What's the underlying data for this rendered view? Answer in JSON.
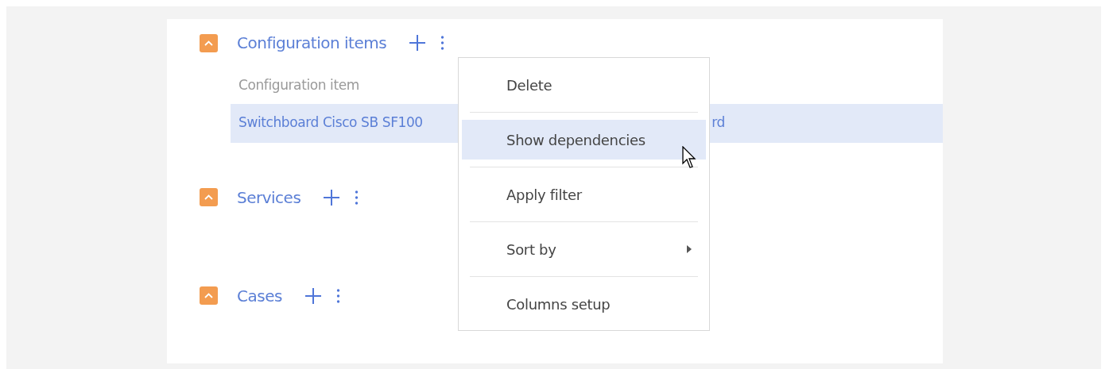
{
  "sections": [
    {
      "title": "Configuration items",
      "expanded": true,
      "table": {
        "columns": [
          "Configuration item"
        ],
        "rows": [
          {
            "text_start": "Switchboard Cisco SB SF100",
            "text_end": "rd",
            "selected": true
          }
        ]
      }
    },
    {
      "title": "Services",
      "expanded": true
    },
    {
      "title": "Cases",
      "expanded": true
    }
  ],
  "context_menu": {
    "items": [
      {
        "label": "Delete",
        "selected": false,
        "submenu": false
      },
      {
        "label": "Show dependencies",
        "selected": true,
        "submenu": false
      },
      {
        "label": "Apply filter",
        "selected": false,
        "submenu": false
      },
      {
        "label": "Sort by",
        "selected": false,
        "submenu": true
      },
      {
        "label": "Columns setup",
        "selected": false,
        "submenu": false
      }
    ]
  }
}
